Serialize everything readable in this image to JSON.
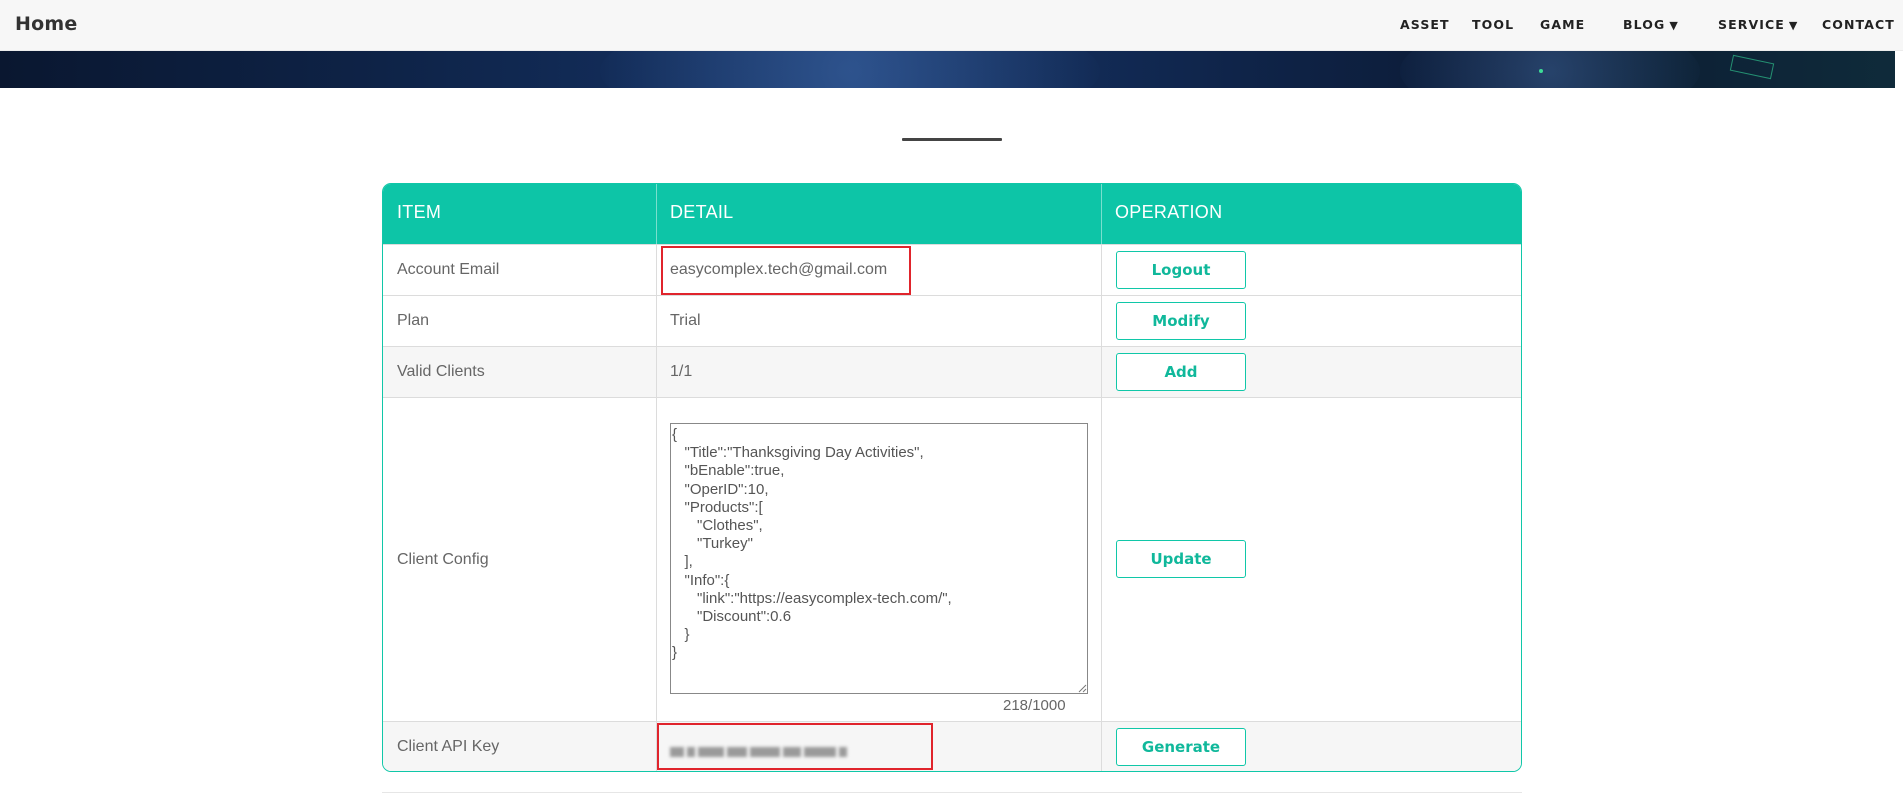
{
  "navbar": {
    "brand": "Home",
    "items": [
      {
        "label": "ASSET"
      },
      {
        "label": "TOOL"
      },
      {
        "label": "GAME"
      },
      {
        "label": "BLOG",
        "caret": "▼"
      },
      {
        "label": "SERVICE",
        "caret": "▼"
      },
      {
        "label": "CONTACT"
      }
    ]
  },
  "table": {
    "headers": [
      "ITEM",
      "DETAIL",
      "OPERATION"
    ],
    "rows": [
      {
        "item": "Account Email",
        "detail": "easycomplex.tech@gmail.com",
        "operation": "Logout"
      },
      {
        "item": "Plan",
        "detail": "Trial",
        "operation": "Modify"
      },
      {
        "item": "Valid Clients",
        "detail": "1/1",
        "operation": "Add"
      },
      {
        "item": "Client Config",
        "detail": "{\n   \"Title\":\"Thanksgiving Day Activities\",\n   \"bEnable\":true,\n   \"OperID\":10,\n   \"Products\":[\n      \"Clothes\",\n      \"Turkey\"\n   ],\n   \"Info\":{\n      \"link\":\"https://easycomplex-tech.com/\",\n      \"Discount\":0.6\n   }\n}",
        "operation": "Update",
        "counter": "218/1000"
      },
      {
        "item": "Client API Key",
        "detail": "",
        "operation": "Generate"
      }
    ]
  },
  "colors": {
    "accent": "#0dc5a7",
    "highlight": "#e0242c"
  }
}
